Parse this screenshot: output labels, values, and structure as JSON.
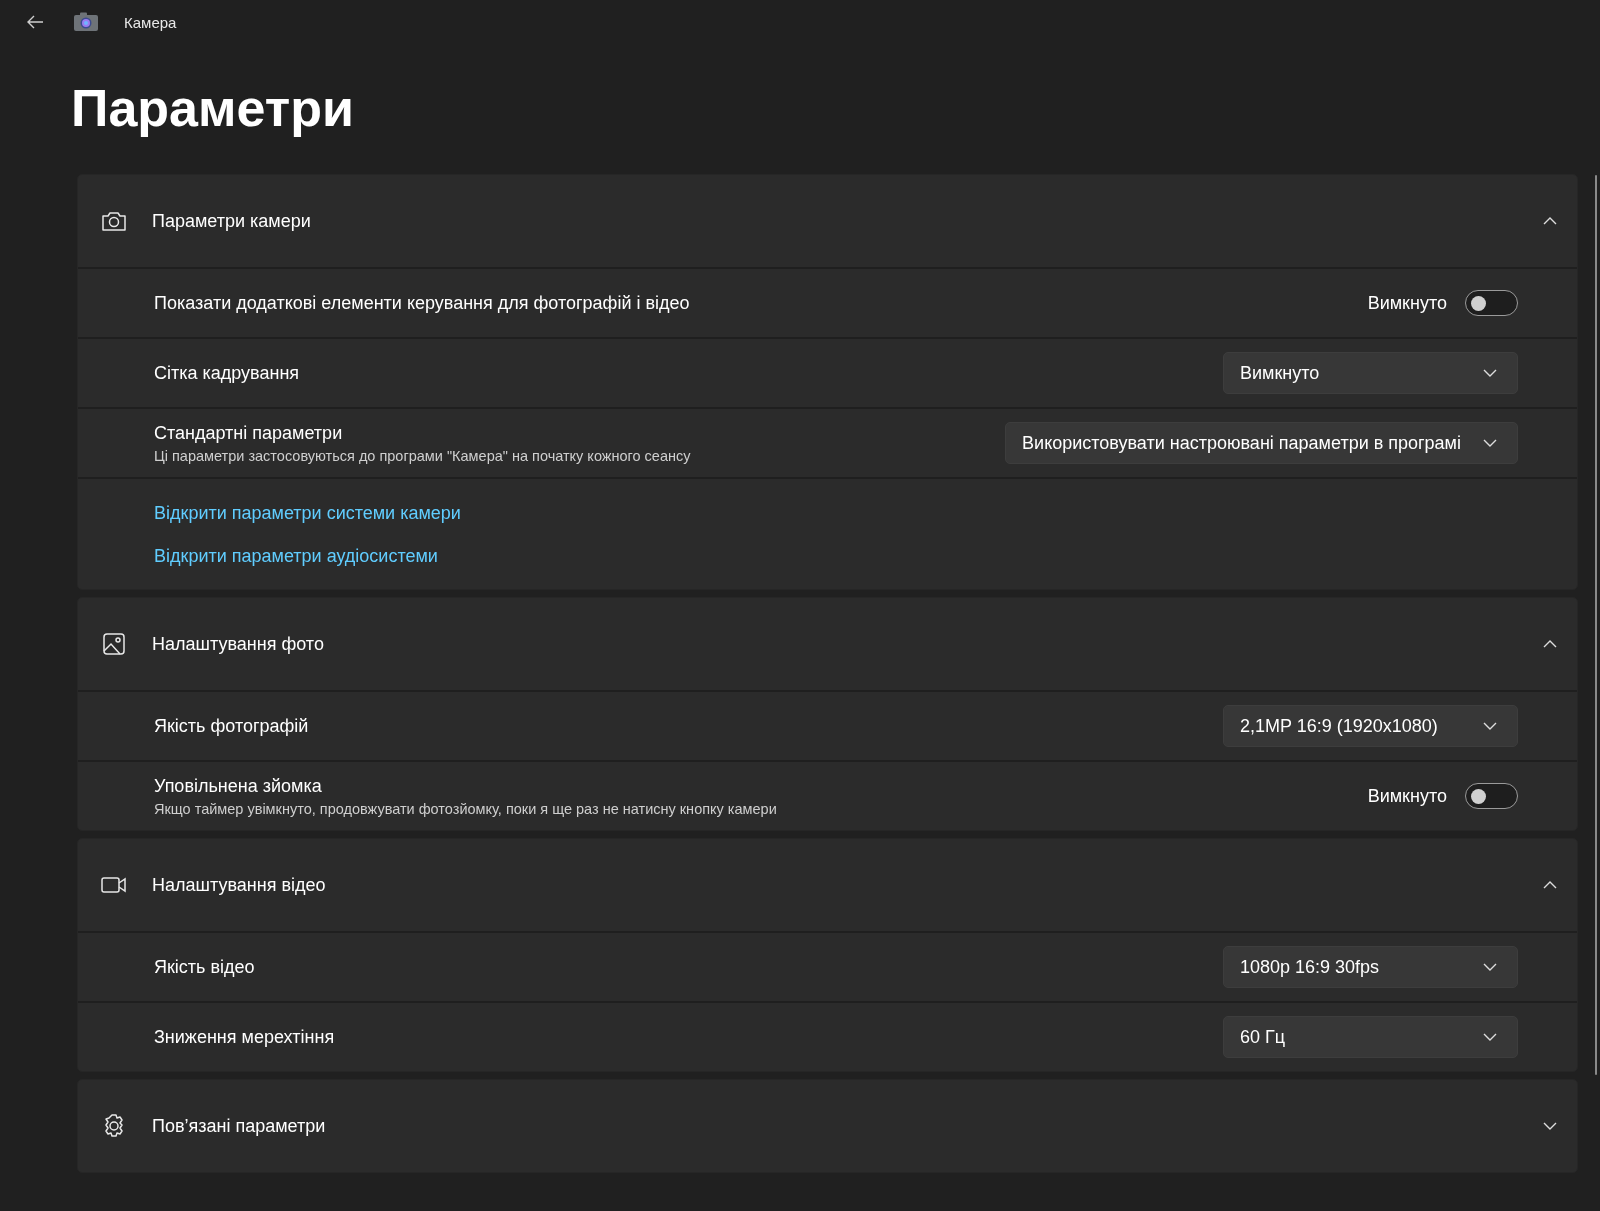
{
  "app": {
    "title": "Камера"
  },
  "page_title": "Параметри",
  "sections": [
    {
      "kind": "camera",
      "title": "Параметри камери",
      "expanded": true,
      "rows": [
        {
          "kind": "toggle",
          "label": "Показати додаткові елементи керування для фотографій і відео",
          "state_label": "Вимкнуто",
          "on": false
        },
        {
          "kind": "dropdown",
          "label": "Сітка кадрування",
          "value": "Вимкнуто"
        },
        {
          "kind": "dropdown",
          "label": "Стандартні параметри",
          "description": "Ці параметри застосовуються до програми \"Камера\" на початку кожного сеансу",
          "value": "Використовувати настроювані параметри в програмі"
        },
        {
          "kind": "links",
          "links": [
            "Відкрити параметри системи камери",
            "Відкрити параметри аудіосистеми"
          ]
        }
      ]
    },
    {
      "kind": "photo",
      "title": "Налаштування фото",
      "expanded": true,
      "rows": [
        {
          "kind": "dropdown",
          "label": "Якість фотографій",
          "value": "2,1MP 16:9 (1920x1080)"
        },
        {
          "kind": "toggle",
          "label": "Уповільнена зйомка",
          "description": "Якщо таймер увімкнуто, продовжувати фотозйомку, поки я ще раз не натисну кнопку камери",
          "state_label": "Вимкнуто",
          "on": false
        }
      ]
    },
    {
      "kind": "video",
      "title": "Налаштування відео",
      "expanded": true,
      "rows": [
        {
          "kind": "dropdown",
          "label": "Якість відео",
          "value": "1080p 16:9 30fps"
        },
        {
          "kind": "dropdown",
          "label": "Зниження мерехтіння",
          "value": "60 Гц"
        }
      ]
    },
    {
      "kind": "gear",
      "title": "Пов’язані параметри",
      "expanded": false
    }
  ]
}
